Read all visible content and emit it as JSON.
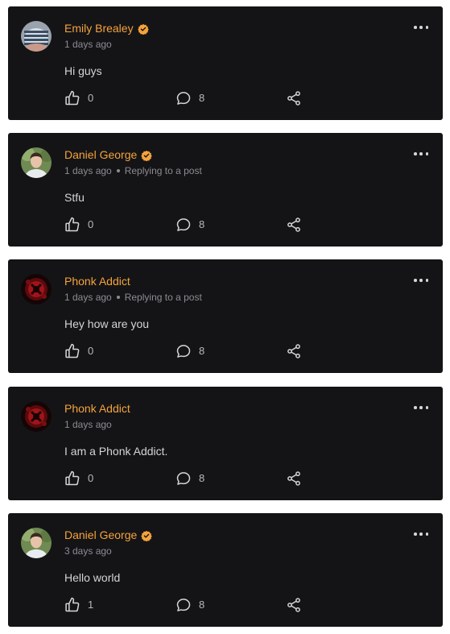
{
  "colors": {
    "card_bg": "#141417",
    "name": "#f5a33a",
    "verified_badge": "#f5a33a",
    "meta_text": "#8c8c92",
    "body_text": "#d4d4d8"
  },
  "icons": {
    "like": "thumbs-up-icon",
    "comment": "comment-bubble-icon",
    "share": "share-icon",
    "more": "more-horizontal-icon",
    "verified": "verified-badge-icon"
  },
  "posts": [
    {
      "author": "Emily Brealey",
      "verified": true,
      "time": "1 days ago",
      "context": "",
      "text": "Hi guys",
      "likes": "0",
      "comments": "8"
    },
    {
      "author": "Daniel George",
      "verified": true,
      "time": "1 days ago",
      "context": "Replying to a post",
      "text": "Stfu",
      "likes": "0",
      "comments": "8"
    },
    {
      "author": "Phonk Addict",
      "verified": false,
      "time": "1 days ago",
      "context": "Replying to a post",
      "text": "Hey how are you",
      "likes": "0",
      "comments": "8"
    },
    {
      "author": "Phonk Addict",
      "verified": false,
      "time": "1 days ago",
      "context": "",
      "text": "I am a Phonk Addict.",
      "likes": "0",
      "comments": "8"
    },
    {
      "author": "Daniel George",
      "verified": true,
      "time": "3 days ago",
      "context": "",
      "text": "Hello world",
      "likes": "1",
      "comments": "8"
    }
  ]
}
